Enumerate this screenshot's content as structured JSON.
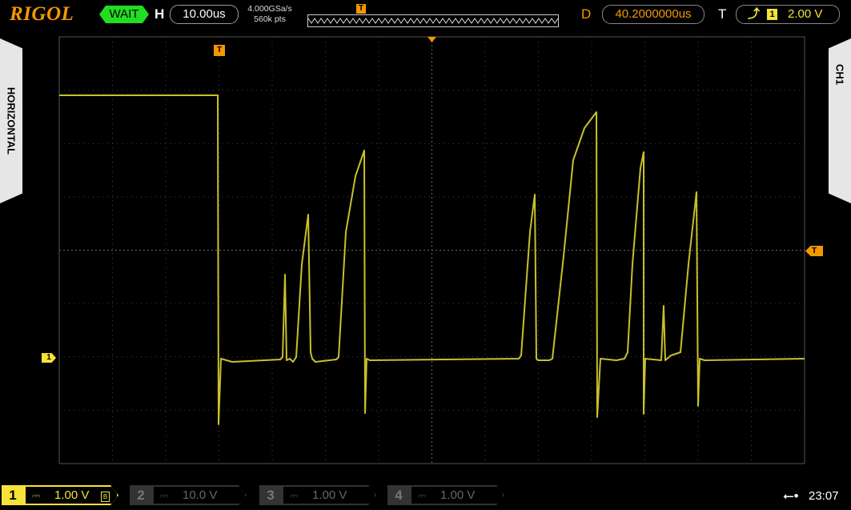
{
  "brand": "RIGOL",
  "run_status": "WAIT",
  "horizontal": {
    "label": "H",
    "timebase": "10.00us",
    "sample_rate": "4.000GSa/s",
    "memory_depth": "560k pts"
  },
  "memory_trigger_mark": "T",
  "delay": {
    "label": "D",
    "value": "40.2000000us"
  },
  "trigger": {
    "label": "T",
    "edge_icon": "rising-edge-icon",
    "source": "1",
    "level": "2.00 V"
  },
  "left_tab": "HORIZONTAL",
  "right_tab": "CH1",
  "markers": {
    "trigger_position": "T",
    "trigger_level": "T",
    "ch1_ground": "1"
  },
  "channels": [
    {
      "num": "1",
      "coupling": "⎓",
      "scale": "1.00 V",
      "bw": "B",
      "active": true
    },
    {
      "num": "2",
      "coupling": "⎓",
      "scale": "10.0 V",
      "active": false
    },
    {
      "num": "3",
      "coupling": "⎓",
      "scale": "1.00 V",
      "active": false
    },
    {
      "num": "4",
      "coupling": "⎓",
      "scale": "1.00 V",
      "active": false
    }
  ],
  "clock": "23:07",
  "colors": {
    "ch1": "#f6e23a",
    "accent": "#f39800",
    "status_wait": "#22dd22",
    "trace": "#c8c02a"
  }
}
